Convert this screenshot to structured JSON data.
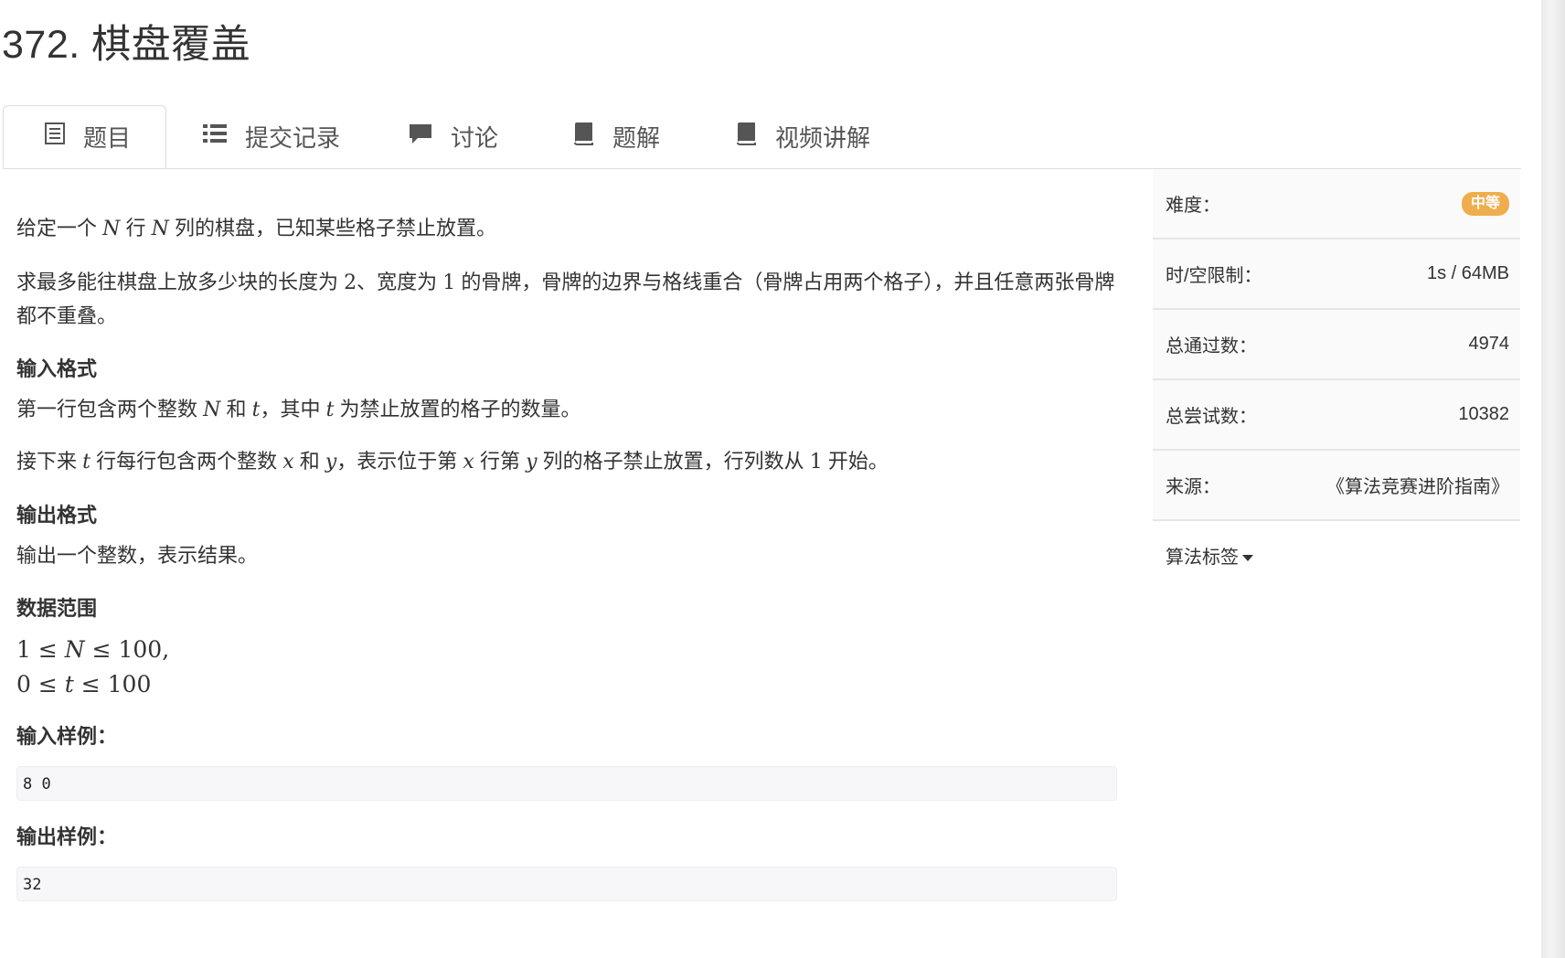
{
  "title": "372. 棋盘覆盖",
  "tabs": [
    {
      "label": "题目",
      "icon": "list-alt-icon",
      "active": true
    },
    {
      "label": "提交记录",
      "icon": "list-icon"
    },
    {
      "label": "讨论",
      "icon": "comment-icon"
    },
    {
      "label": "题解",
      "icon": "book-icon"
    },
    {
      "label": "视频讲解",
      "icon": "book-icon"
    }
  ],
  "problem": {
    "p1": {
      "a": "给定一个 ",
      "b": "N",
      "c": " 行 ",
      "d": "N",
      "e": " 列的棋盘，已知某些格子禁止放置。"
    },
    "p2": {
      "a": "求最多能往棋盘上放多少块的长度为 ",
      "b": "2",
      "c": "、宽度为 ",
      "d": "1",
      "e": " 的骨牌，骨牌的边界与格线重合（骨牌占用两个格子），并且任意两张骨牌都不重叠。"
    },
    "input_heading": "输入格式",
    "in1": {
      "a": "第一行包含两个整数 ",
      "b": "N",
      "c": " 和 ",
      "d": "t",
      "e": "，其中 ",
      "f": "t",
      "g": " 为禁止放置的格子的数量。"
    },
    "in2": {
      "a": "接下来 ",
      "b": "t",
      "c": " 行每行包含两个整数 ",
      "d": "x",
      "e": " 和 ",
      "f": "y",
      "g": "，表示位于第 ",
      "h": "x",
      "i": " 行第 ",
      "j": "y",
      "k": " 列的格子禁止放置，行列数从 ",
      "l": "1",
      "m": " 开始。"
    },
    "output_heading": "输出格式",
    "out1": "输出一个整数，表示结果。",
    "range_heading": "数据范围",
    "range1": {
      "a": "1",
      "b": " ≤ ",
      "c": "N",
      "d": " ≤ ",
      "e": "100",
      "f": ","
    },
    "range2": {
      "a": "0",
      "b": " ≤ ",
      "c": "t",
      "d": " ≤ ",
      "e": "100"
    },
    "input_sample_heading": "输入样例：",
    "input_sample": "8 0",
    "output_sample_heading": "输出样例：",
    "output_sample": "32"
  },
  "sidebar": {
    "difficulty_label": "难度：",
    "difficulty_value": "中等",
    "limit_label": "时/空限制：",
    "limit_value": "1s / 64MB",
    "passed_label": "总通过数：",
    "passed_value": "4974",
    "tries_label": "总尝试数：",
    "tries_value": "10382",
    "source_label": "来源：",
    "source_value": "《算法竞赛进阶指南》",
    "tags_label": "算法标签"
  },
  "colors": {
    "badge": "#f0ad4e",
    "border": "#dddddd"
  }
}
